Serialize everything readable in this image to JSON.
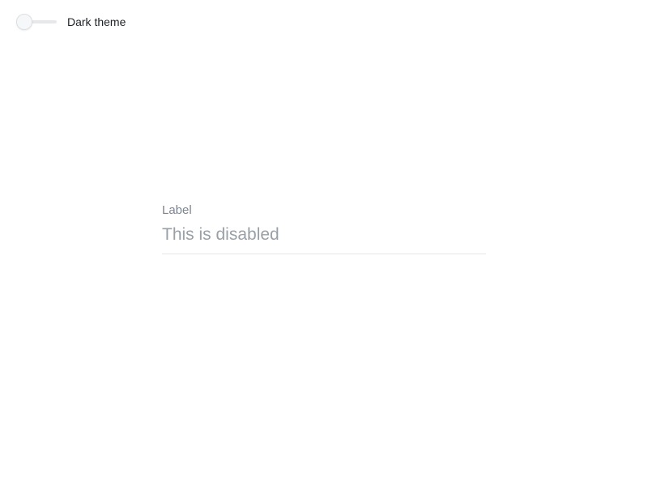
{
  "theme_toggle": {
    "label": "Dark theme",
    "checked": false
  },
  "text_field": {
    "label": "Label",
    "placeholder": "This is disabled",
    "value": "",
    "disabled": true
  }
}
